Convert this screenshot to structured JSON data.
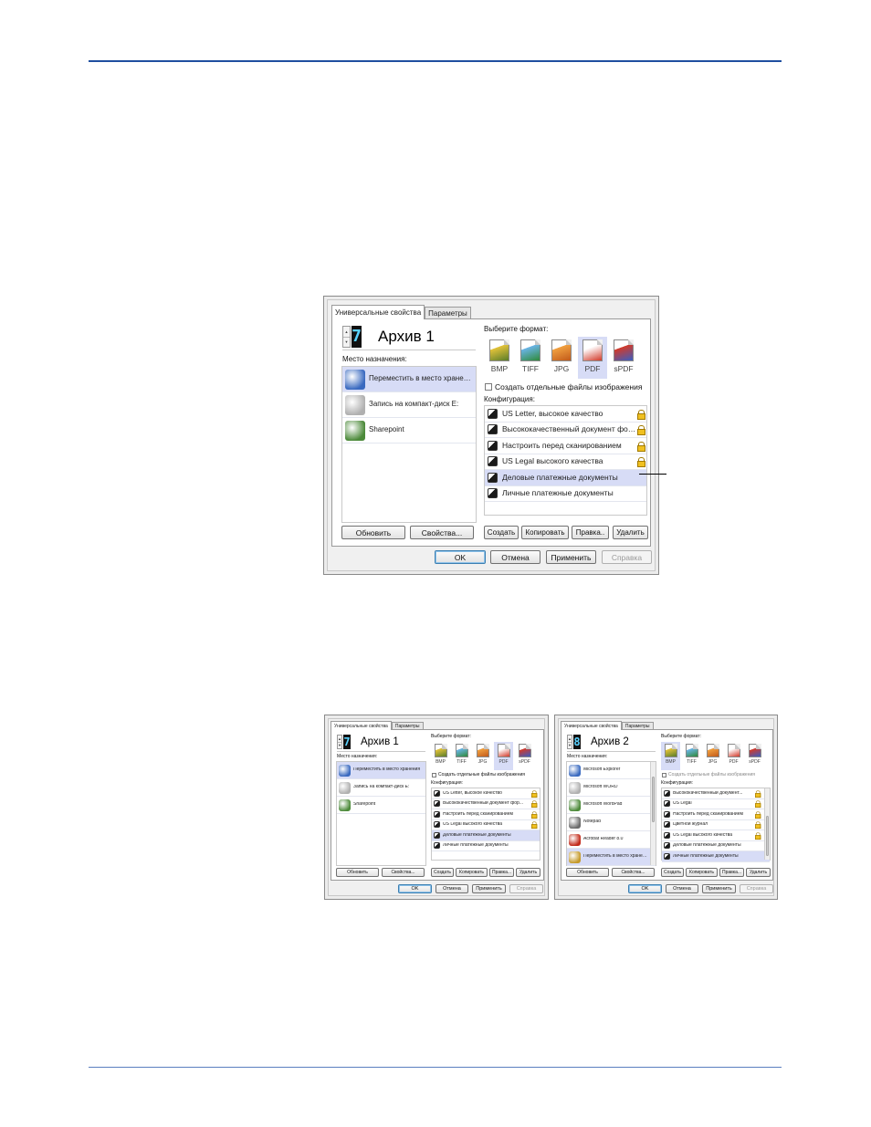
{
  "main_dialog": {
    "tabs": [
      "Универсальные свойства",
      "Параметры"
    ],
    "profile_number": "7",
    "profile_name": "Архив 1",
    "destination_label": "Место назначения:",
    "destinations": [
      {
        "label": "Переместить в место хранения",
        "icon": "folder-icon",
        "selected": true
      },
      {
        "label": "Запись на компакт-диск E:",
        "icon": "cd-drive-icon",
        "selected": false
      },
      {
        "label": "Sharepoint",
        "icon": "sharepoint-icon",
        "selected": false
      }
    ],
    "format_label": "Выберите формат:",
    "formats": [
      {
        "label": "BMP",
        "selected": false
      },
      {
        "label": "TIFF",
        "selected": false
      },
      {
        "label": "JPG",
        "selected": false
      },
      {
        "label": "PDF",
        "selected": true
      },
      {
        "label": "sPDF",
        "selected": false
      }
    ],
    "separate_files_label": "Создать отдельные файлы изображения",
    "config_label": "Конфигурация:",
    "configs": [
      {
        "label": "US Letter, высокое качество",
        "locked": true,
        "selected": false
      },
      {
        "label": "Высококачественный документ фор...",
        "locked": true,
        "selected": false
      },
      {
        "label": "Настроить перед сканированием",
        "locked": true,
        "selected": false
      },
      {
        "label": "US Legal высокого качества",
        "locked": true,
        "selected": false
      },
      {
        "label": "Деловые платежные документы",
        "locked": false,
        "selected": true
      },
      {
        "label": "Личные платежные документы",
        "locked": false,
        "selected": false
      }
    ],
    "buttons": {
      "refresh": "Обновить",
      "properties": "Свойства...",
      "create": "Создать",
      "copy": "Копировать",
      "edit": "Правка..",
      "delete": "Удалить",
      "ok": "OK",
      "cancel": "Отмена",
      "apply": "Применить",
      "help": "Справка"
    }
  },
  "small_dialog_1": {
    "tabs": [
      "Универсальные свойства",
      "Параметры"
    ],
    "profile_number": "7",
    "profile_name": "Архив 1",
    "destination_label": "Место назначения:",
    "destinations": [
      {
        "label": "Переместить в место хранения",
        "selected": true
      },
      {
        "label": "Запись на компакт-диск E:",
        "selected": false
      },
      {
        "label": "Sharepoint",
        "selected": false
      }
    ],
    "format_label": "Выберите формат:",
    "formats": [
      {
        "label": "BMP",
        "selected": false
      },
      {
        "label": "TIFF",
        "selected": false
      },
      {
        "label": "JPG",
        "selected": false
      },
      {
        "label": "PDF",
        "selected": true
      },
      {
        "label": "sPDF",
        "selected": false
      }
    ],
    "separate_files_label": "Создать отдельные файлы изображения",
    "config_label": "Конфигурация:",
    "configs": [
      {
        "label": "US Letter, высокое качество",
        "locked": true,
        "selected": false
      },
      {
        "label": "Высококачественный документ фор...",
        "locked": true,
        "selected": false
      },
      {
        "label": "Настроить перед сканированием",
        "locked": true,
        "selected": false
      },
      {
        "label": "US Legal высокого качества",
        "locked": true,
        "selected": false
      },
      {
        "label": "Деловые платежные документы",
        "locked": false,
        "selected": true
      },
      {
        "label": "Личные платежные документы",
        "locked": false,
        "selected": false
      }
    ],
    "buttons": {
      "refresh": "Обновить",
      "properties": "Свойства...",
      "create": "Создать",
      "copy": "Копировать",
      "edit": "Правка...",
      "delete": "Удалить",
      "ok": "OK",
      "cancel": "Отмена",
      "apply": "Применить",
      "help": "Справка"
    }
  },
  "small_dialog_2": {
    "tabs": [
      "Универсальные свойства",
      "Параметры"
    ],
    "profile_number": "8",
    "profile_name": "Архив 2",
    "destination_label": "Место назначения:",
    "destinations": [
      {
        "label": "Microsoft Explorer",
        "selected": false
      },
      {
        "label": "Microsoft WORD",
        "selected": false
      },
      {
        "label": "Microsoft WordPad",
        "selected": false
      },
      {
        "label": "Notepad",
        "selected": false
      },
      {
        "label": "Acrobat Reader 8.0",
        "selected": false
      },
      {
        "label": "Переместить в место хранения",
        "selected": true
      }
    ],
    "format_label": "Выберите формат:",
    "formats": [
      {
        "label": "BMP",
        "selected": true
      },
      {
        "label": "TIFF",
        "selected": false
      },
      {
        "label": "JPG",
        "selected": false
      },
      {
        "label": "PDF",
        "selected": false
      },
      {
        "label": "sPDF",
        "selected": false
      }
    ],
    "separate_files_label": "Создать отдельные файлы изображения",
    "config_label": "Конфигурация:",
    "configs": [
      {
        "label": "Высококачественный документ...",
        "locked": true,
        "selected": false
      },
      {
        "label": "US Legal",
        "locked": true,
        "selected": false
      },
      {
        "label": "Настроить перед сканированием",
        "locked": true,
        "selected": false
      },
      {
        "label": "Цветной журнал",
        "locked": true,
        "selected": false
      },
      {
        "label": "US Legal высокого качества",
        "locked": true,
        "selected": false
      },
      {
        "label": "Деловые платежные документы",
        "locked": false,
        "selected": false
      },
      {
        "label": "Личные платежные документы",
        "locked": false,
        "selected": true
      }
    ],
    "buttons": {
      "refresh": "Обновить",
      "properties": "Свойства...",
      "create": "Создать",
      "copy": "Копировать",
      "edit": "Правка...",
      "delete": "Удалить",
      "ok": "OK",
      "cancel": "Отмена",
      "apply": "Применить",
      "help": "Справка"
    }
  },
  "colors": {
    "rule": "#1f4fa0",
    "selection": "#d7dcf6",
    "digit": "#5ad2ff",
    "pdf": "#d23a2a"
  }
}
